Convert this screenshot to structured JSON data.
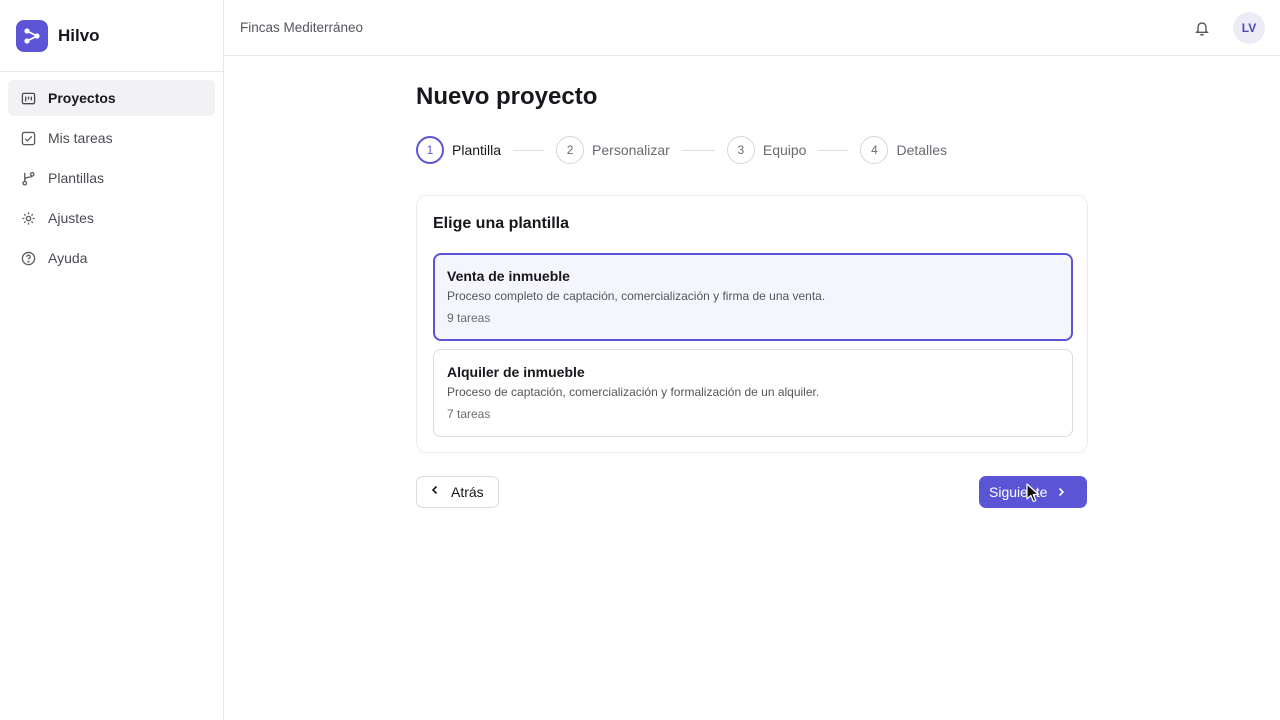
{
  "app": {
    "name": "Hilvo",
    "logo_icon": "share-nodes-icon",
    "accent": "#5b55d6"
  },
  "sidebar": {
    "items": [
      {
        "label": "Proyectos",
        "icon": "kanban-icon",
        "active": true
      },
      {
        "label": "Mis tareas",
        "icon": "checkbox-icon",
        "active": false
      },
      {
        "label": "Plantillas",
        "icon": "branch-icon",
        "active": false
      },
      {
        "label": "Ajustes",
        "icon": "gear-icon",
        "active": false
      },
      {
        "label": "Ayuda",
        "icon": "help-circle-icon",
        "active": false
      }
    ]
  },
  "topbar": {
    "organization": "Fincas Mediterráneo",
    "notifications_icon": "bell-icon",
    "avatar_initials": "LV"
  },
  "page": {
    "title": "Nuevo proyecto"
  },
  "stepper": {
    "steps": [
      {
        "number": "1",
        "label": "Plantilla",
        "active": true
      },
      {
        "number": "2",
        "label": "Personalizar",
        "active": false
      },
      {
        "number": "3",
        "label": "Equipo",
        "active": false
      },
      {
        "number": "4",
        "label": "Detalles",
        "active": false
      }
    ]
  },
  "templates": {
    "heading": "Elige una plantilla",
    "items": [
      {
        "title": "Venta de inmueble",
        "description": "Proceso completo de captación, comercialización y firma de una venta.",
        "count": "9 tareas",
        "selected": true
      },
      {
        "title": "Alquiler de inmueble",
        "description": "Proceso de captación, comercialización y formalización de un alquiler.",
        "count": "7 tareas",
        "selected": false
      }
    ]
  },
  "actions": {
    "back_label": "Atrás",
    "next_label": "Siguiente"
  }
}
